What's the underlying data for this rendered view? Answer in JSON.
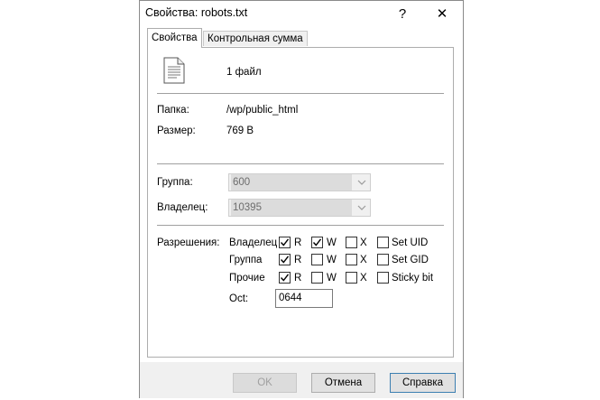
{
  "window": {
    "title": "Свойства: robots.txt",
    "help_glyph": "?",
    "close_glyph": "✕"
  },
  "tabs": [
    {
      "label": "Свойства",
      "active": true
    },
    {
      "label": "Контрольная сумма",
      "active": false
    }
  ],
  "file": {
    "icon": "text-file-icon",
    "count_label": "1 файл"
  },
  "info": {
    "folder_label": "Папка:",
    "folder_value": "/wp/public_html",
    "size_label": "Размер:",
    "size_value": "769 B"
  },
  "ownership": {
    "group_label": "Группа:",
    "group_value": "600",
    "owner_label": "Владелец:",
    "owner_value": "10395"
  },
  "permissions": {
    "label": "Разрешения:",
    "rows": [
      {
        "name": "Владелец",
        "r": true,
        "w": true,
        "x": false,
        "extra": "Set UID",
        "extra_checked": false
      },
      {
        "name": "Группа",
        "r": true,
        "w": false,
        "x": false,
        "extra": "Set GID",
        "extra_checked": false
      },
      {
        "name": "Прочие",
        "r": true,
        "w": false,
        "x": false,
        "extra": "Sticky bit",
        "extra_checked": false
      }
    ],
    "r_label": "R",
    "w_label": "W",
    "x_label": "X",
    "octal_label": "Oct:",
    "octal_value": "0644"
  },
  "buttons": {
    "ok": "OK",
    "cancel": "Отмена",
    "help": "Справка"
  }
}
